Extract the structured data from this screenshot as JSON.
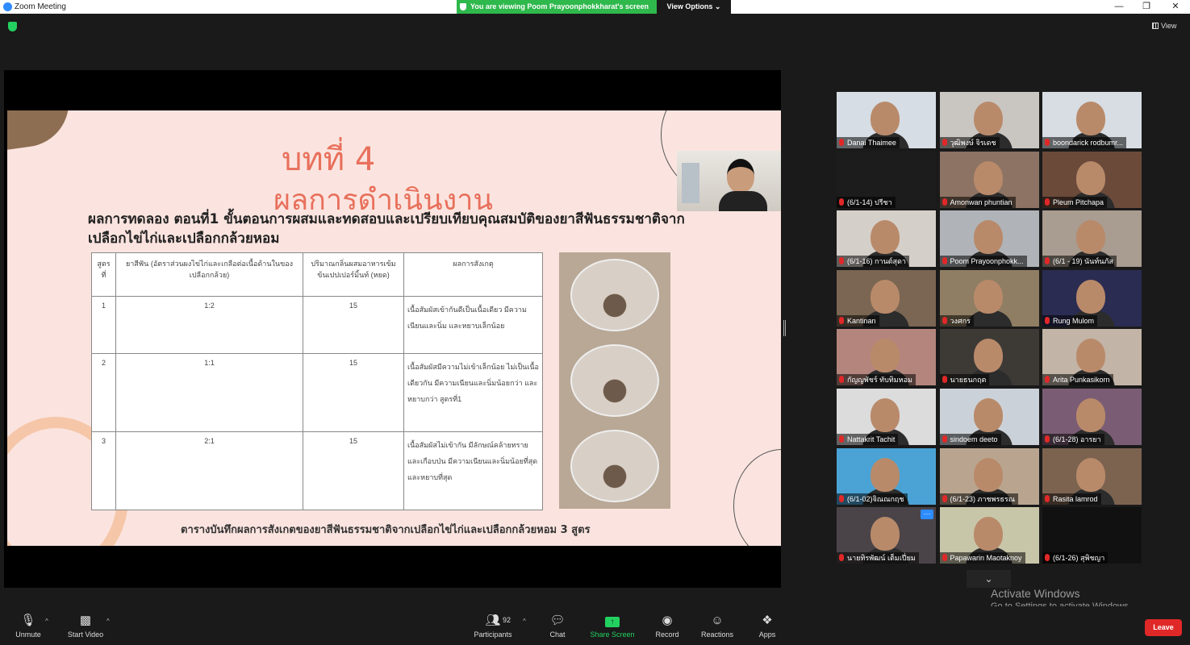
{
  "window": {
    "title": "Zoom Meeting"
  },
  "banner": {
    "share_text": "You are viewing Poom Prayoonphokkharat's screen",
    "view_options": "View Options ⌄"
  },
  "view_button": "View",
  "slide": {
    "title": "บทที่ 4",
    "subtitle": "ผลการดำเนินงาน",
    "heading": "ผลการทดลอง ตอนที่1 ขั้นตอนการผสมและทดสอบและเปรียบเทียบคุณสมบัติของยาสีฟันธรรมชาติจากเปลือกไข่ไก่และเปลือกกล้วยหอม",
    "table": {
      "headers": [
        "สูตร ที่",
        "ยาสีฟัน (อัตราส่วนผงไข่ไก่และเกลือต่อเนื้อด้านในของเปลือกกล้วย)",
        "ปริมาณกลิ่นผสมอาหารเข้มข้นเปปเปอร์มิ้นท์ (หยด)",
        "ผลการสังเกตุ"
      ],
      "rows": [
        [
          "1",
          "1:2",
          "15",
          "เนื้อสัมผัสเข้ากันดีเป็นเนื้อเดียว มีความเนียนและนิ่ม และหยาบเล็กน้อย"
        ],
        [
          "2",
          "1:1",
          "15",
          "เนื้อสัมผัสมีความไม่เข้าเล็กน้อย ไม่เป็นเนื้อเดียวกัน มีความเนียนและนิ่มน้อยกว่า และหยาบกว่า สูตรที่1"
        ],
        [
          "3",
          "2:1",
          "15",
          "เนื้อสัมผัสไม่เข้ากัน มีลักษณ์คล้ายทรายและเกือบป่น มีความเนียนและนิ่มน้อยที่สุด และหยาบที่สุด"
        ]
      ]
    },
    "caption": "ตารางบันทึกผลการสังเกตของยาสีฟันธรรมชาติจากเปลือกไข่ไก่และเปลือกกล้วยหอม 3 สูตร"
  },
  "participants_tiles": [
    {
      "name": "Danai Thaimee",
      "bg": "#d7dde4"
    },
    {
      "name": "วุฒิพงษ์ จิรเดช",
      "bg": "#c9c6c2"
    },
    {
      "name": "boondarick rodbumr...",
      "bg": "#d8dde3"
    },
    {
      "name": "(6/1-14) ปรีชา",
      "bg": "#1c1c1c"
    },
    {
      "name": "Amonwan phuntian",
      "bg": "#8d7363"
    },
    {
      "name": "Pleum Pitchapa",
      "bg": "#6b4a3a"
    },
    {
      "name": "(6/1-16) กานต์สุดา",
      "bg": "#d5cfc9"
    },
    {
      "name": "Poom Prayoonphokk...",
      "bg": "#b0b4b8"
    },
    {
      "name": "(6/1 - 19) นันท์นภัส",
      "bg": "#a99c90"
    },
    {
      "name": "Kantinan",
      "bg": "#7a6652"
    },
    {
      "name": "วงศกร",
      "bg": "#8f7e63"
    },
    {
      "name": "Rung Mulom",
      "bg": "#2b2c52"
    },
    {
      "name": "กัญญพัชร์ ทับทิมหอม",
      "bg": "#b4857d"
    },
    {
      "name": "นายธนกฤต",
      "bg": "#3d3a36"
    },
    {
      "name": "Arita Punkasikorn",
      "bg": "#c2b4a6"
    },
    {
      "name": "Nattakrit Tachit",
      "bg": "#dcdcdc"
    },
    {
      "name": "sindoem deeto",
      "bg": "#cbd1d8"
    },
    {
      "name": "(6/1-28) อารยา",
      "bg": "#7a5d74"
    },
    {
      "name": "(6/1-02)จิณณกฤช",
      "bg": "#4aa3d4"
    },
    {
      "name": "(6/1-23) ภาชพรธรณ",
      "bg": "#b9a58f"
    },
    {
      "name": "Rasita lamrod",
      "bg": "#7c6350"
    },
    {
      "name": "นายทิรพัฒน์ เต็มเปี่ยม",
      "bg": "#4a4448"
    },
    {
      "name": "Papawarin Maotaknoy",
      "bg": "#c8c6a8"
    },
    {
      "name": "(6/1-26) สุพิชญา",
      "bg": "#111111"
    }
  ],
  "watermark": {
    "line1": "Activate Windows",
    "line2": "Go to Settings to activate Windows."
  },
  "toolbar": {
    "unmute": "Unmute",
    "start_video": "Start Video",
    "participants": "Participants",
    "participants_count": "92",
    "chat": "Chat",
    "share_screen": "Share Screen",
    "record": "Record",
    "reactions": "Reactions",
    "apps": "Apps",
    "leave": "Leave"
  }
}
